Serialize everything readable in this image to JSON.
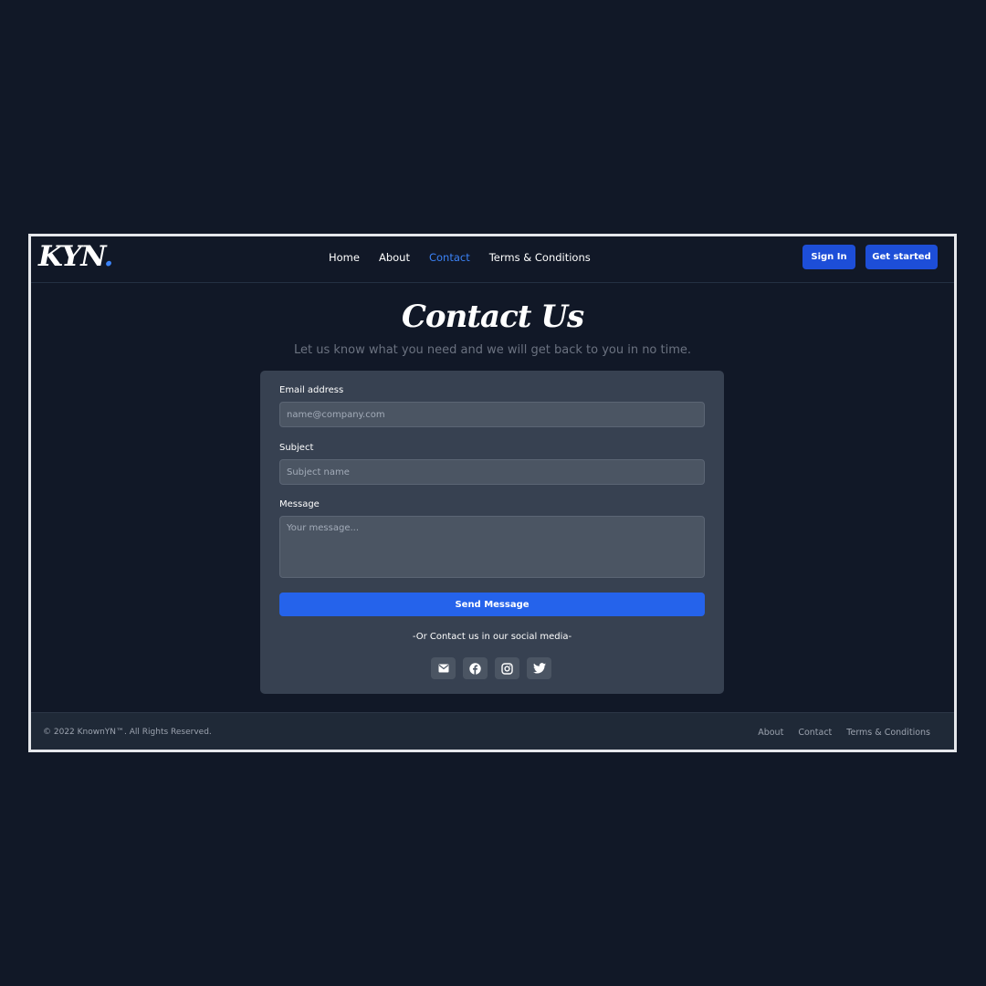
{
  "brand": {
    "logo_text": "KYN",
    "logo_dot": "."
  },
  "nav": {
    "links": [
      "Home",
      "About",
      "Contact",
      "Terms & Conditions"
    ],
    "active": "Contact",
    "sign_in": "Sign In",
    "get_started": "Get started"
  },
  "header": {
    "title": "Contact Us",
    "subtitle": "Let us know what you need and we will get back to you in no time."
  },
  "form": {
    "email_label": "Email address",
    "email_placeholder": "name@company.com",
    "subject_label": "Subject",
    "subject_placeholder": "Subject name",
    "message_label": "Message",
    "message_placeholder": "Your message...",
    "send_label": "Send Message",
    "social_text": "-Or Contact us in our social media-",
    "social_icons": [
      "mail-icon",
      "facebook-icon",
      "instagram-icon",
      "twitter-icon"
    ]
  },
  "footer": {
    "copyright": "© 2022 KnownYN™. All Rights Reserved.",
    "links": [
      "About",
      "Contact",
      "Terms & Conditions"
    ]
  },
  "colors": {
    "page_bg": "#111827",
    "card_bg": "#374151",
    "accent": "#2563eb",
    "active_link": "#3b82f6"
  }
}
